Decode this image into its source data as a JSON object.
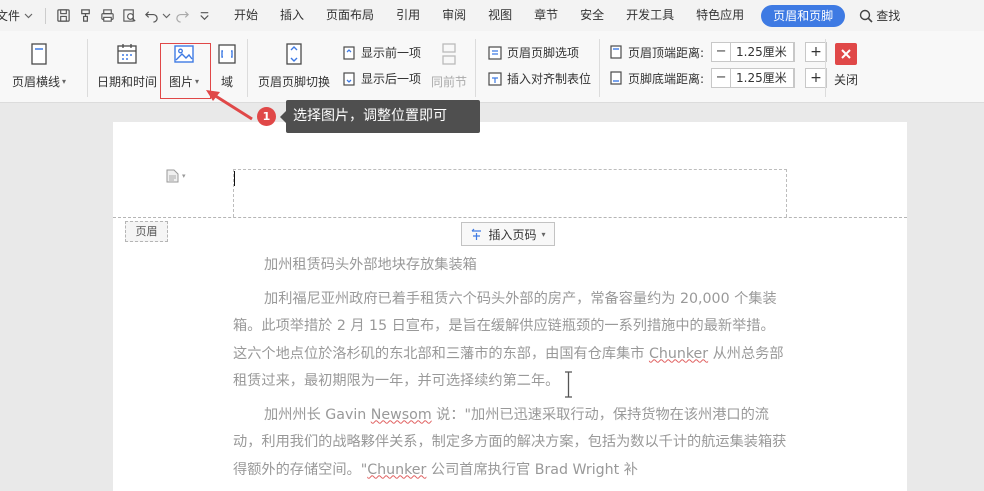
{
  "menubar": {
    "file_label": "文件",
    "tabs": [
      "开始",
      "插入",
      "页面布局",
      "引用",
      "审阅",
      "视图",
      "章节",
      "安全",
      "开发工具",
      "特色应用",
      "页眉和页脚"
    ],
    "active_tab": "页眉和页脚",
    "search_label": "查找"
  },
  "ribbon": {
    "header_line_label": "页眉横线",
    "date_time_label": "日期和时间",
    "picture_label": "图片",
    "field_label": "域",
    "switch_label": "页眉页脚切换",
    "show_prev_label": "显示前一项",
    "show_next_label": "显示后一项",
    "same_as_prev_label": "同前节",
    "hf_options_label": "页眉页脚选项",
    "insert_align_tab_label": "插入对齐制表位",
    "header_top_label": "页眉顶端距离:",
    "header_top_value": "1.25厘米",
    "footer_bottom_label": "页脚底端距离:",
    "footer_bottom_value": "1.25厘米",
    "close_label": "关闭"
  },
  "tooltip": {
    "badge": "1",
    "text": "选择图片，调整位置即可"
  },
  "document": {
    "header_tag": "页眉",
    "insert_page_number": "插入页码",
    "title": "加州租赁码头外部地块存放集装箱",
    "para1": "加利福尼亚州政府已着手租赁六个码头外部的房产，常备容量约为 20,000 个集装箱。此项举措於 2 月 15 日宣布，是旨在缓解供应链瓶颈的一系列措施中的最新举措。这六个地点位於洛杉矶的东北部和三藩市的东部，由国有仓库集市 ",
    "para1_word": "Chunker",
    "para1_tail": " 从州总务部租赁过来，最初期限为一年，并可选择续约第二年。",
    "para2_head": "加州州长 Gavin ",
    "para2_word": "Newsom",
    "para2_mid": " 说：\"加州已迅速采取行动，保持货物在该州港口的流动，利用我们的战略夥伴关系，制定多方面的解决方案，包括为数以千计的航运集装箱获得额外的存储空间。\"",
    "para2_word2": "Chunker",
    "para2_tail": " 公司首席执行官 Brad Wright 补"
  },
  "colors": {
    "accent": "#3e7ae3",
    "annotation": "#e04848",
    "close_button": "#e04848"
  }
}
